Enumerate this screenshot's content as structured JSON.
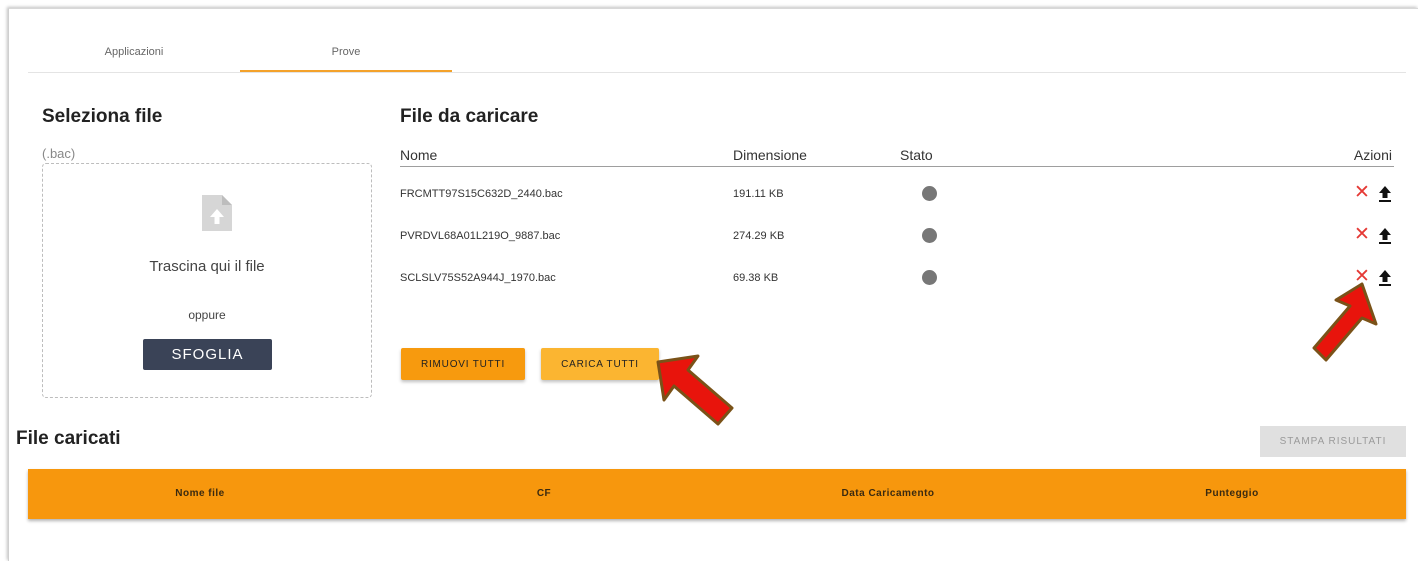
{
  "tabs": [
    {
      "label": "Applicazioni"
    },
    {
      "label": "Prove"
    }
  ],
  "select_panel": {
    "title": "Seleziona file",
    "extension": "(.bac)",
    "drop_text": "Trascina qui il file",
    "or_text": "oppure",
    "browse_label": "SFOGLIA"
  },
  "upload_panel": {
    "title": "File da caricare",
    "columns": {
      "name": "Nome",
      "size": "Dimensione",
      "status": "Stato",
      "actions": "Azioni"
    },
    "files": [
      {
        "name": "FRCMTT97S15C632D_2440.bac",
        "size": "191.11 KB"
      },
      {
        "name": "PVRDVL68A01L219O_9887.bac",
        "size": "274.29 KB"
      },
      {
        "name": "SCLSLV75S52A944J_1970.bac",
        "size": "69.38 KB"
      }
    ],
    "remove_all_label": "RIMUOVI TUTTI",
    "upload_all_label": "CARICA TUTTI"
  },
  "uploaded_panel": {
    "title": "File caricati",
    "print_label": "STAMPA RISULTATI",
    "columns": [
      "Nome file",
      "CF",
      "Data Caricamento",
      "Punteggio"
    ]
  },
  "icons": {
    "status": "grey-dot-icon",
    "remove": "close-icon",
    "upload": "upload-icon",
    "file": "file-upload-icon"
  },
  "colors": {
    "accent": "#f7970d",
    "remove_icon": "#e53935",
    "browse_button": "#3a4357",
    "annotation_arrow": "#e8140c"
  }
}
